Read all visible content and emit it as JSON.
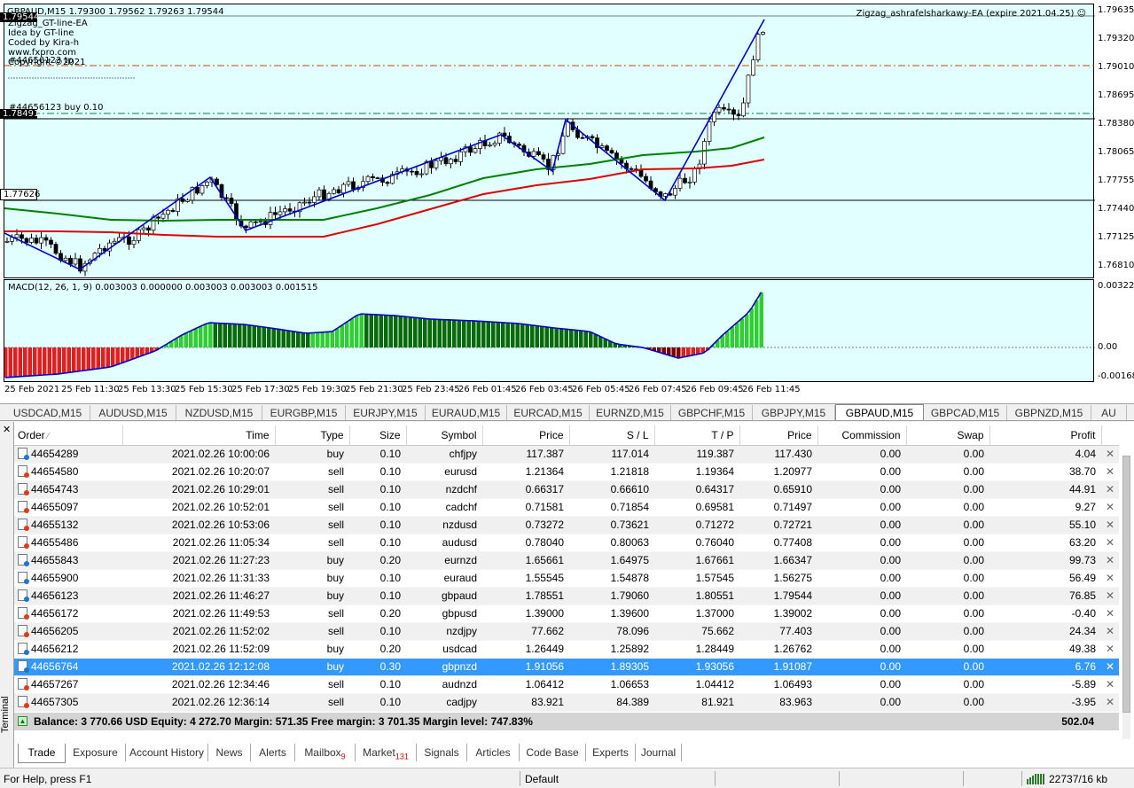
{
  "chart": {
    "header": "GBPAUD,M15  1.79300 1.79562 1.79263 1.79544",
    "ea_label": "Zigzag_ashrafelsharkawy-EA (expire 2021.04.25)",
    "info_lines": [
      "Zigzag_GT-line-EA",
      "Idea by GT-line",
      "Coded by Kira-h",
      "www.fxpro.com",
      "Copyright ©2021"
    ],
    "order_label_tp": "#44656123 tp",
    "order_label_buy": "#44656123 buy 0.10",
    "price_labels": [
      "1.79635",
      "1.79320",
      "1.79010",
      "1.78695",
      "1.78380",
      "1.78065",
      "1.77755",
      "1.77440",
      "1.77125",
      "1.76810"
    ],
    "current_price": "1.79544",
    "buy_price": "1.78491",
    "sl_price": "1.77626",
    "macd_label": "MACD(12, 26, 1, 9) 0.003003 0.000000 0.003003 0.003003 0.001515",
    "macd_scale": [
      "0.003227",
      "0.00",
      "-0.001686"
    ],
    "time_labels": [
      "25 Feb 2021",
      "25 Feb 11:30",
      "25 Feb 13:30",
      "25 Feb 15:30",
      "25 Feb 17:30",
      "25 Feb 19:30",
      "25 Feb 21:30",
      "25 Feb 23:45",
      "26 Feb 01:45",
      "26 Feb 03:45",
      "26 Feb 05:45",
      "26 Feb 07:45",
      "26 Feb 09:45",
      "26 Feb 11:45"
    ],
    "colors": {
      "background": "#e1ffff",
      "bull": "#ffffff",
      "bear": "#000000",
      "zigzag": "#0000cc",
      "ma_fast": "#008000",
      "ma_slow": "#e00000",
      "macd_up": "#32cd32",
      "macd_down": "#cc0000"
    }
  },
  "chart_tabs": [
    "USDCAD,M15",
    "AUDUSD,M15",
    "NZDUSD,M15",
    "EURGBP,M15",
    "EURJPY,M15",
    "EURAUD,M15",
    "EURCAD,M15",
    "EURNZD,M15",
    "GBPCHF,M15",
    "GBPJPY,M15",
    "GBPAUD,M15",
    "GBPCAD,M15",
    "GBPNZD,M15",
    "AU"
  ],
  "active_chart_tab": "GBPAUD,M15",
  "table": {
    "headers": [
      "Order",
      "Time",
      "Type",
      "Size",
      "Symbol",
      "Price",
      "S / L",
      "T / P",
      "Price",
      "Commission",
      "Swap",
      "Profit"
    ],
    "rows": [
      [
        "44654289",
        "2021.02.26 10:00:06",
        "buy",
        "0.10",
        "chfjpy",
        "117.387",
        "117.014",
        "119.387",
        "117.430",
        "0.00",
        "0.00",
        "4.04"
      ],
      [
        "44654580",
        "2021.02.26 10:20:07",
        "sell",
        "0.10",
        "eurusd",
        "1.21364",
        "1.21818",
        "1.19364",
        "1.20977",
        "0.00",
        "0.00",
        "38.70"
      ],
      [
        "44654743",
        "2021.02.26 10:29:01",
        "sell",
        "0.10",
        "nzdchf",
        "0.66317",
        "0.66610",
        "0.64317",
        "0.65910",
        "0.00",
        "0.00",
        "44.91"
      ],
      [
        "44655097",
        "2021.02.26 10:52:01",
        "sell",
        "0.10",
        "cadchf",
        "0.71581",
        "0.71854",
        "0.69581",
        "0.71497",
        "0.00",
        "0.00",
        "9.27"
      ],
      [
        "44655132",
        "2021.02.26 10:53:06",
        "sell",
        "0.10",
        "nzdusd",
        "0.73272",
        "0.73621",
        "0.71272",
        "0.72721",
        "0.00",
        "0.00",
        "55.10"
      ],
      [
        "44655486",
        "2021.02.26 11:05:34",
        "sell",
        "0.10",
        "audusd",
        "0.78040",
        "0.80063",
        "0.76040",
        "0.77408",
        "0.00",
        "0.00",
        "63.20"
      ],
      [
        "44655843",
        "2021.02.26 11:27:23",
        "buy",
        "0.20",
        "eurnzd",
        "1.65661",
        "1.64975",
        "1.67661",
        "1.66347",
        "0.00",
        "0.00",
        "99.73"
      ],
      [
        "44655900",
        "2021.02.26 11:31:33",
        "buy",
        "0.10",
        "euraud",
        "1.55545",
        "1.54878",
        "1.57545",
        "1.56275",
        "0.00",
        "0.00",
        "56.49"
      ],
      [
        "44656123",
        "2021.02.26 11:46:27",
        "buy",
        "0.10",
        "gbpaud",
        "1.78551",
        "1.79060",
        "1.80551",
        "1.79544",
        "0.00",
        "0.00",
        "76.85"
      ],
      [
        "44656172",
        "2021.02.26 11:49:53",
        "sell",
        "0.20",
        "gbpusd",
        "1.39000",
        "1.39600",
        "1.37000",
        "1.39002",
        "0.00",
        "0.00",
        "-0.40"
      ],
      [
        "44656205",
        "2021.02.26 11:52:02",
        "sell",
        "0.10",
        "nzdjpy",
        "77.662",
        "78.096",
        "75.662",
        "77.403",
        "0.00",
        "0.00",
        "24.34"
      ],
      [
        "44656212",
        "2021.02.26 11:52:09",
        "buy",
        "0.20",
        "usdcad",
        "1.26449",
        "1.25892",
        "1.28449",
        "1.26762",
        "0.00",
        "0.00",
        "49.38"
      ],
      [
        "44656764",
        "2021.02.26 12:12:08",
        "buy",
        "0.30",
        "gbpnzd",
        "1.91056",
        "1.89305",
        "1.93056",
        "1.91087",
        "0.00",
        "0.00",
        "6.76"
      ],
      [
        "44657267",
        "2021.02.26 12:34:46",
        "sell",
        "0.10",
        "audnzd",
        "1.06412",
        "1.06653",
        "1.04412",
        "1.06493",
        "0.00",
        "0.00",
        "-5.89"
      ],
      [
        "44657305",
        "2021.02.26 12:36:14",
        "sell",
        "0.10",
        "cadjpy",
        "83.921",
        "84.389",
        "81.921",
        "83.963",
        "0.00",
        "0.00",
        "-3.95"
      ]
    ],
    "selected_order": "44656764"
  },
  "balance": {
    "text": "Balance: 3 770.66 USD  Equity: 4 272.70  Margin: 571.35  Free margin: 3 701.35  Margin level: 747.83%",
    "total_profit": "502.04"
  },
  "terminal": {
    "side_label": "Terminal",
    "tabs": [
      {
        "label": "Trade",
        "badge": ""
      },
      {
        "label": "Exposure",
        "badge": ""
      },
      {
        "label": "Account History",
        "badge": ""
      },
      {
        "label": "News",
        "badge": ""
      },
      {
        "label": "Alerts",
        "badge": ""
      },
      {
        "label": "Mailbox",
        "badge": "9"
      },
      {
        "label": "Market",
        "badge": "131"
      },
      {
        "label": "Signals",
        "badge": ""
      },
      {
        "label": "Articles",
        "badge": ""
      },
      {
        "label": "Code Base",
        "badge": ""
      },
      {
        "label": "Experts",
        "badge": ""
      },
      {
        "label": "Journal",
        "badge": ""
      }
    ],
    "active_tab": "Trade"
  },
  "status": {
    "help": "For Help, press F1",
    "profile": "Default",
    "traffic": "22737/16 kb"
  }
}
